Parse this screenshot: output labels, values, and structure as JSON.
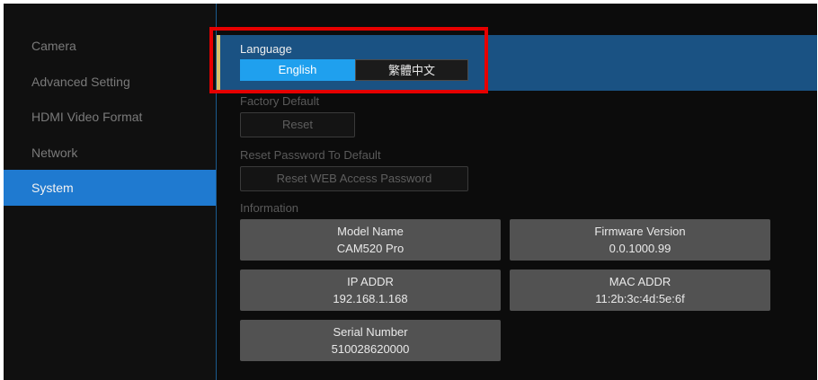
{
  "sidebar": {
    "items": [
      {
        "label": "Camera"
      },
      {
        "label": "Advanced Setting"
      },
      {
        "label": "HDMI Video Format"
      },
      {
        "label": "Network"
      },
      {
        "label": "System"
      }
    ]
  },
  "language": {
    "label": "Language",
    "options": [
      "English",
      "繁體中文"
    ],
    "selected": "English"
  },
  "factory_default": {
    "label": "Factory Default",
    "button": "Reset"
  },
  "reset_password": {
    "label": "Reset Password To Default",
    "button": "Reset WEB Access Password"
  },
  "information": {
    "label": "Information",
    "model_name": {
      "key": "Model Name",
      "value": "CAM520 Pro"
    },
    "firmware_version": {
      "key": "Firmware Version",
      "value": "0.0.1000.99"
    },
    "ip_addr": {
      "key": "IP ADDR",
      "value": "192.168.1.168"
    },
    "mac_addr": {
      "key": "MAC ADDR",
      "value": "11:2b:3c:4d:5e:6f"
    },
    "serial_number": {
      "key": "Serial Number",
      "value": "510028620000"
    }
  },
  "colors": {
    "active_sidebar": "#1f7ad0",
    "selected_option": "#1fa0ee",
    "highlight_outline": "#e60000"
  }
}
